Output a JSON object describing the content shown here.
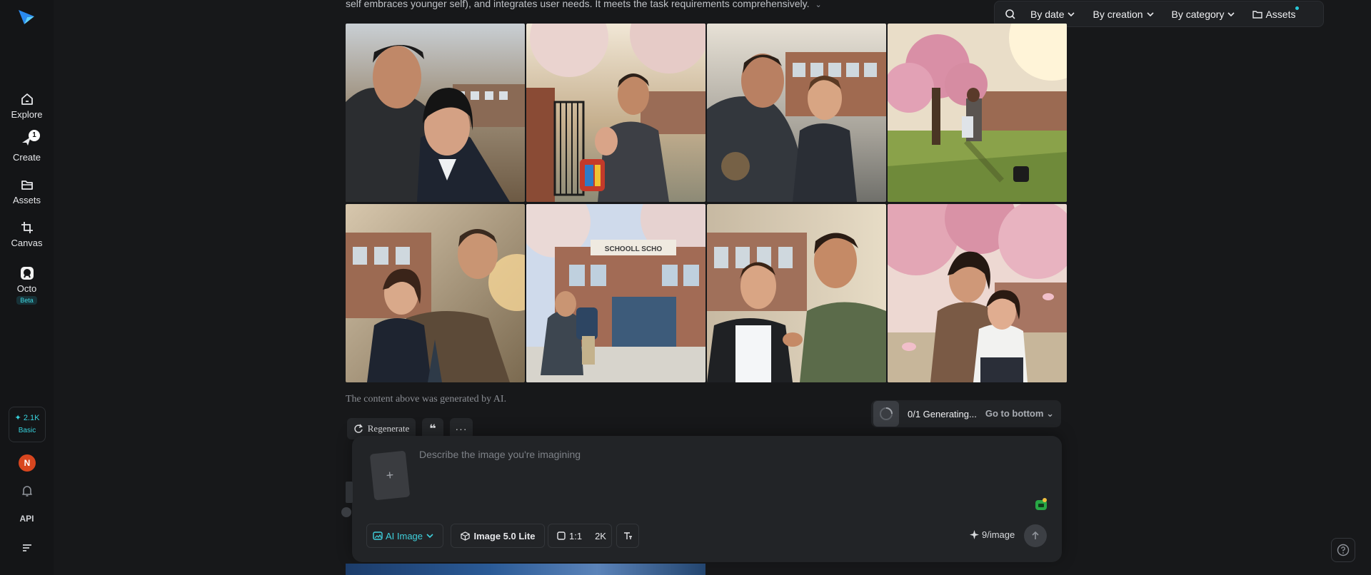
{
  "sidebar": {
    "items": [
      {
        "label": "Explore",
        "icon": "home-icon"
      },
      {
        "label": "Create",
        "icon": "create-icon",
        "badge": "1"
      },
      {
        "label": "Assets",
        "icon": "folder-icon"
      },
      {
        "label": "Canvas",
        "icon": "crop-icon"
      },
      {
        "label": "Octo",
        "icon": "octo-icon",
        "badge": "Beta"
      }
    ],
    "credits": {
      "value": "2.1K",
      "plan": "Basic"
    },
    "avatar_initial": "N",
    "api_label": "API"
  },
  "topbar": {
    "by_date": "By date",
    "by_creation": "By creation",
    "by_category": "By category",
    "assets": "Assets"
  },
  "content": {
    "summary_text": "self embraces younger self), and integrates user needs. It meets the task requirements comprehensively.",
    "disclaimer": "The content above was generated by AI.",
    "regenerate": "Regenerate",
    "quote_icon": "❝",
    "more_icon": "···",
    "images": [
      {
        "name": "image-1",
        "desc": "man hugging girl at school"
      },
      {
        "name": "image-2",
        "desc": "father hugging boy at gate"
      },
      {
        "name": "image-3",
        "desc": "man and boy smiling"
      },
      {
        "name": "image-4",
        "desc": "two figures under cherry tree"
      },
      {
        "name": "image-5",
        "desc": "man hugging girl in blazer"
      },
      {
        "name": "image-6",
        "desc": "man kneeling at school entrance"
      },
      {
        "name": "image-7",
        "desc": "man adjusting boy's collar"
      },
      {
        "name": "image-8",
        "desc": "woman hugging girl under blossoms"
      }
    ],
    "school_sign": "SCHOOLL SCHO"
  },
  "generation": {
    "count": "0/1 Generating...",
    "go_to_bottom": "Go to bottom"
  },
  "composer": {
    "placeholder": "Describe the image you're imagining",
    "add_ref": "+",
    "mode": "AI Image",
    "model": "Image 5.0 Lite",
    "ratio": "1:1",
    "resolution": "2K",
    "cost": "9/image"
  },
  "colors": {
    "accent": "#3fd0dc",
    "background": "#17181a",
    "panel": "#222427",
    "avatar": "#d8461f"
  }
}
